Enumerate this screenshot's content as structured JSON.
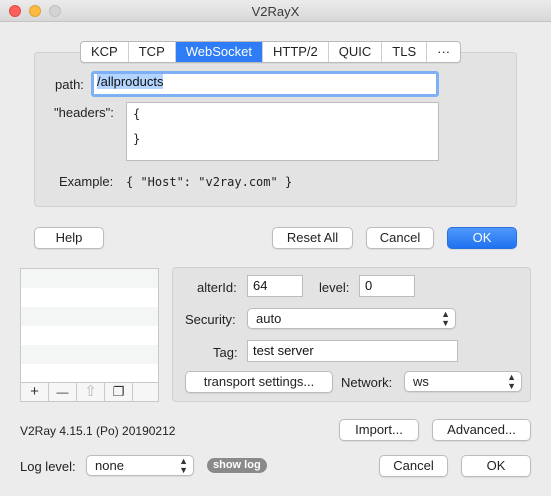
{
  "window": {
    "title": "V2RayX"
  },
  "tabs": [
    "KCP",
    "TCP",
    "WebSocket",
    "HTTP/2",
    "QUIC",
    "TLS",
    "···"
  ],
  "active_tab": "WebSocket",
  "ws": {
    "path_label": "path:",
    "path_value": "/allproducts",
    "headers_label": "\"headers\":",
    "headers_line1": "{",
    "headers_line2": "}",
    "example_label": "Example:",
    "example_value": "{ \"Host\": \"v2ray.com\" }"
  },
  "dialog_buttons": {
    "help": "Help",
    "reset_all": "Reset All",
    "cancel": "Cancel",
    "ok": "OK"
  },
  "server": {
    "alterid_label": "alterId:",
    "alterid_value": "64",
    "level_label": "level:",
    "level_value": "0",
    "security_label": "Security:",
    "security_value": "auto",
    "tag_label": "Tag:",
    "tag_value": "test server",
    "transport_button": "transport settings...",
    "network_label": "Network:",
    "network_value": "ws"
  },
  "list_toolbar": {
    "add": "+",
    "remove": "—",
    "share": "⇧",
    "duplicate": "❐"
  },
  "footer": {
    "version": "V2Ray 4.15.1 (Po) 20190212",
    "import": "Import...",
    "advanced": "Advanced...",
    "log_level_label": "Log level:",
    "log_level_value": "none",
    "show_log": "show log",
    "cancel": "Cancel",
    "ok": "OK"
  },
  "colors": {
    "accent": "#2f7df6",
    "window_bg": "#ececec"
  }
}
